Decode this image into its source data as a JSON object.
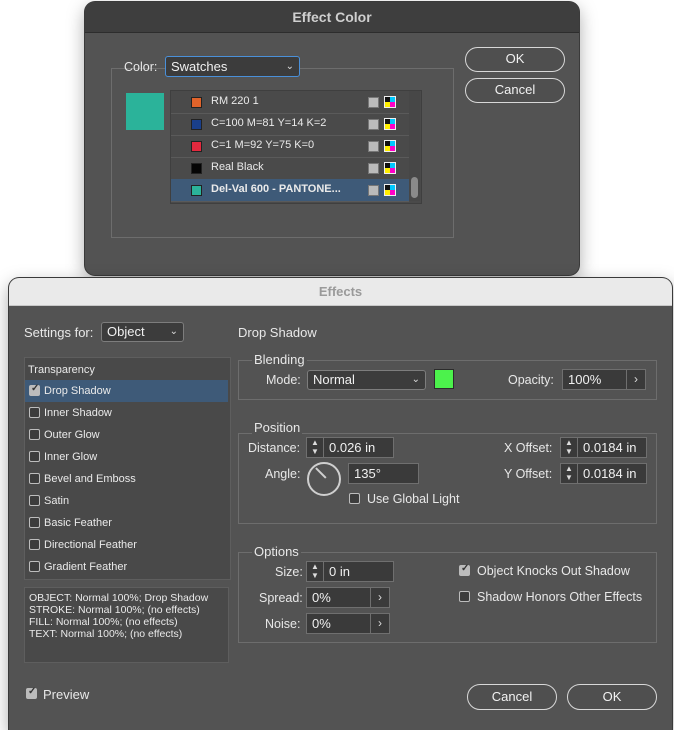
{
  "effect_color": {
    "title": "Effect Color",
    "color_label": "Color:",
    "color_value": "Swatches",
    "ok": "OK",
    "cancel": "Cancel",
    "preview_color": "#2bb39a",
    "swatches": [
      {
        "name": "RM 220 1",
        "color": "#e0632a"
      },
      {
        "name": "C=100 M=81 Y=14 K=2",
        "color": "#1a3f8a"
      },
      {
        "name": "C=1 M=92 Y=75 K=0",
        "color": "#e4293e"
      },
      {
        "name": "Real Black",
        "color": "#050505"
      },
      {
        "name": "Del-Val 600 - PANTONE...",
        "color": "#2bb39a"
      }
    ]
  },
  "effects": {
    "title": "Effects",
    "settings_for_label": "Settings for:",
    "settings_for_value": "Object",
    "list_header": "Transparency",
    "list_items": [
      {
        "label": "Drop Shadow",
        "checked": true
      },
      {
        "label": "Inner Shadow",
        "checked": false
      },
      {
        "label": "Outer Glow",
        "checked": false
      },
      {
        "label": "Inner Glow",
        "checked": false
      },
      {
        "label": "Bevel and Emboss",
        "checked": false
      },
      {
        "label": "Satin",
        "checked": false
      },
      {
        "label": "Basic Feather",
        "checked": false
      },
      {
        "label": "Directional Feather",
        "checked": false
      },
      {
        "label": "Gradient Feather",
        "checked": false
      }
    ],
    "summary": [
      "OBJECT: Normal 100%; Drop Shadow",
      "STROKE: Normal 100%; (no effects)",
      "FILL: Normal 100%; (no effects)",
      "TEXT: Normal 100%; (no effects)"
    ],
    "preview_label": "Preview",
    "cancel": "Cancel",
    "ok": "OK",
    "section_title": "Drop Shadow",
    "blending": {
      "title": "Blending",
      "mode_label": "Mode:",
      "mode_value": "Normal",
      "color": "#4cf24c",
      "opacity_label": "Opacity:",
      "opacity_value": "100%"
    },
    "position": {
      "title": "Position",
      "distance_label": "Distance:",
      "distance_value": "0.026 in",
      "angle_label": "Angle:",
      "angle_value": "135°",
      "global_light_label": "Use Global Light",
      "x_offset_label": "X Offset:",
      "x_offset_value": "0.0184 in",
      "y_offset_label": "Y Offset:",
      "y_offset_value": "0.0184 in"
    },
    "options": {
      "title": "Options",
      "size_label": "Size:",
      "size_value": "0 in",
      "spread_label": "Spread:",
      "spread_value": "0%",
      "noise_label": "Noise:",
      "noise_value": "0%",
      "knocks_out_label": "Object Knocks Out Shadow",
      "honors_label": "Shadow Honors Other Effects"
    }
  }
}
